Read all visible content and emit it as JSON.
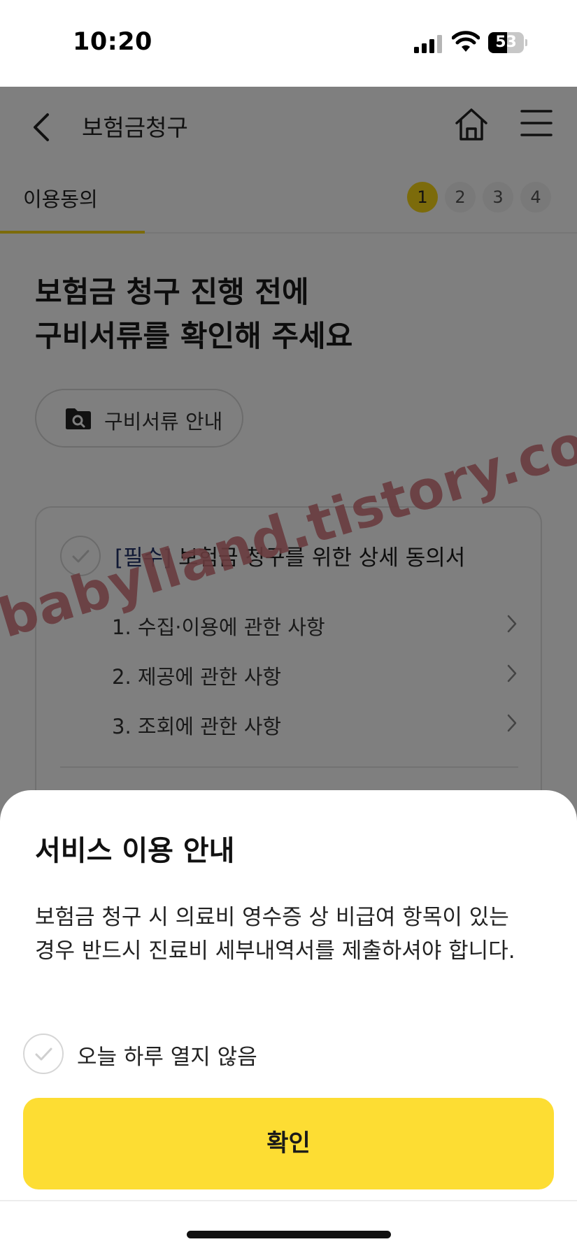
{
  "status_bar": {
    "time": "10:20",
    "battery_percent": 53,
    "battery_text": "53",
    "icons": [
      "signal-icon",
      "wifi-icon",
      "battery-icon"
    ]
  },
  "header": {
    "title": "보험금청구",
    "icons": [
      "back-icon",
      "home-icon",
      "menu-icon"
    ]
  },
  "steps": {
    "label": "이용동의",
    "items": [
      "1",
      "2",
      "3",
      "4"
    ],
    "active_index": 0,
    "accent_color": "#f8d616"
  },
  "main": {
    "title": "보험금 청구 진행 전에\n구비서류를 확인해 주세요",
    "docs_button": {
      "label": "구비서류 안내",
      "icon": "folder-search-icon"
    },
    "consent": {
      "required_tag": "[필수]",
      "title": " 보험금 청구를 위한 상세 동의서",
      "items": [
        "1. 수집·이용에 관한 사항",
        "2. 제공에 관한 사항",
        "3. 조회에 관한 사항"
      ]
    },
    "watermark": "babylland.tistory.com"
  },
  "sheet": {
    "title": "서비스 이용 안내",
    "body": "보험금 청구 시 의료비 영수증 상 비급여 항목이 있는\n경우 반드시 진료비 세부내역서를 제출하셔야 합니다.",
    "dismiss_label": "오늘 하루 열지 않음",
    "confirm_label": "확인",
    "confirm_color": "#fddd33"
  }
}
